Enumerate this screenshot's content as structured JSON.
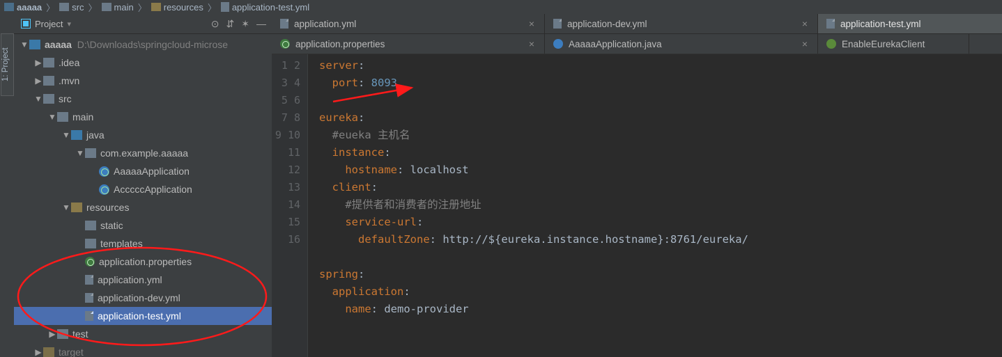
{
  "breadcrumb": {
    "items": [
      "aaaaa",
      "src",
      "main",
      "resources",
      "application-test.yml"
    ]
  },
  "sidebar_tab": "1: Project",
  "project": {
    "title": "Project",
    "root": {
      "name": "aaaaa",
      "path": "D:\\Downloads\\springcloud-microse"
    },
    "idea": ".idea",
    "mvn": ".mvn",
    "src": "src",
    "main": "main",
    "java": "java",
    "pkg": "com.example.aaaaa",
    "cls1": "AaaaaApplication",
    "cls2": "AcccccApplication",
    "resources": "resources",
    "static": "static",
    "templates": "templates",
    "props": "application.properties",
    "yml0": "application.yml",
    "yml1": "application-dev.yml",
    "yml2": "application-test.yml",
    "test": "test",
    "target": "target"
  },
  "tabs1": {
    "t0": "application.yml",
    "t1": "application-dev.yml",
    "t2": "application-test.yml"
  },
  "tabs2": {
    "t0": "application.properties",
    "t1": "AaaaaApplication.java",
    "t2": "EnableEurekaClient"
  },
  "code": {
    "lines": [
      "1",
      "2",
      "3",
      "4",
      "5",
      "6",
      "7",
      "8",
      "9",
      "10",
      "11",
      "12",
      "13",
      "14",
      "15",
      "16"
    ],
    "l1_k": "server",
    "l1_c": ":",
    "l2_k": "port",
    "l2_c": ": ",
    "l2_v": "8093",
    "l4_k": "eureka",
    "l4_c": ":",
    "l5": "  #eueka 主机名",
    "l6_k": "instance",
    "l6_c": ":",
    "l7_k": "hostname",
    "l7_c": ": ",
    "l7_v": "localhost",
    "l8_k": "client",
    "l8_c": ":",
    "l9": "    #提供者和消费者的注册地址",
    "l10_k": "service-url",
    "l10_c": ":",
    "l11_k": "defaultZone",
    "l11_c": ": ",
    "l11_v": "http://${eureka.instance.hostname}:8761/eureka/",
    "l13_k": "spring",
    "l13_c": ":",
    "l14_k": "application",
    "l14_c": ":",
    "l15_k": "name",
    "l15_c": ": ",
    "l15_v": "demo-provider"
  }
}
